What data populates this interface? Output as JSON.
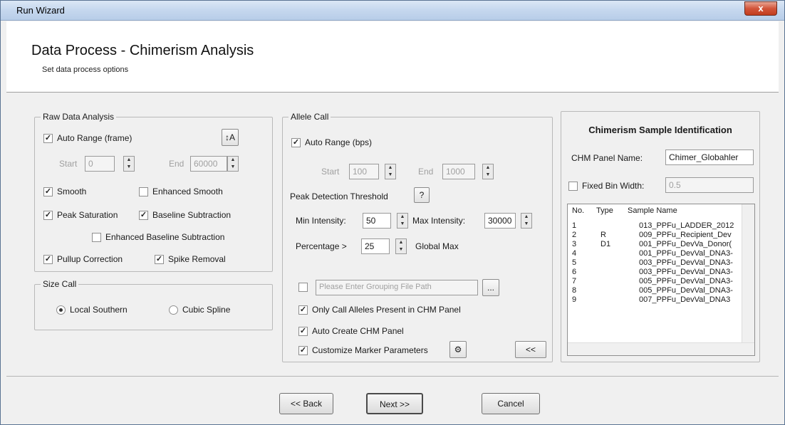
{
  "window": {
    "title": "Run Wizard",
    "close_label": "x"
  },
  "header": {
    "title": "Data Process - Chimerism Analysis",
    "subtitle": "Set data process options"
  },
  "raw": {
    "title": "Raw Data Analysis",
    "auto_range": "Auto Range (frame)",
    "start_label": "Start",
    "start_value": "0",
    "end_label": "End",
    "end_value": "60000",
    "smooth": "Smooth",
    "enhanced_smooth": "Enhanced Smooth",
    "peak_saturation": "Peak Saturation",
    "baseline_subtraction": "Baseline Subtraction",
    "enhanced_baseline": "Enhanced Baseline Subtraction",
    "pullup": "Pullup Correction",
    "spike": "Spike Removal"
  },
  "size": {
    "title": "Size Call",
    "local": "Local Southern",
    "cubic": "Cubic Spline"
  },
  "allele": {
    "title": "Allele Call",
    "auto_range": "Auto Range (bps)",
    "start_label": "Start",
    "start_value": "100",
    "end_label": "End",
    "end_value": "1000",
    "pdt_label": "Peak Detection Threshold",
    "help": "?",
    "min_label": "Min Intensity:",
    "min_value": "50",
    "max_label": "Max Intensity:",
    "max_value": "30000",
    "pct_label": "Percentage >",
    "pct_value": "25",
    "global_max": "Global Max",
    "grouping_placeholder": "Please Enter Grouping File Path",
    "browse": "...",
    "only_call": "Only Call Alleles Present in CHM Panel",
    "auto_create": "Auto Create CHM Panel",
    "customize": "Customize Marker Parameters",
    "collapse": "<<"
  },
  "chm": {
    "title": "Chimerism Sample Identification",
    "panel_label": "CHM Panel Name:",
    "panel_value": "Chimer_Globahler",
    "fixed_bin": "Fixed Bin Width:",
    "fixed_value": "0.5",
    "columns": [
      "No.",
      "Type",
      "Sample Name"
    ],
    "rows": [
      [
        "1",
        "",
        "013_PPFu_LADDER_2012"
      ],
      [
        "2",
        "R",
        "009_PPFu_Recipient_Dev"
      ],
      [
        "3",
        "D1",
        "001_PPFu_DevVa_Donor("
      ],
      [
        "4",
        "",
        "001_PPFu_DevVal_DNA3-"
      ],
      [
        "5",
        "",
        "003_PPFu_DevVal_DNA3-"
      ],
      [
        "6",
        "",
        "003_PPFu_DevVal_DNA3-"
      ],
      [
        "7",
        "",
        "005_PPFu_DevVal_DNA3-"
      ],
      [
        "8",
        "",
        "005_PPFu_DevVal_DNA3-"
      ],
      [
        "9",
        "",
        "007_PPFu_DevVal_DNA3"
      ]
    ]
  },
  "footer": {
    "back": "<< Back",
    "next": "Next >>",
    "cancel": "Cancel"
  }
}
